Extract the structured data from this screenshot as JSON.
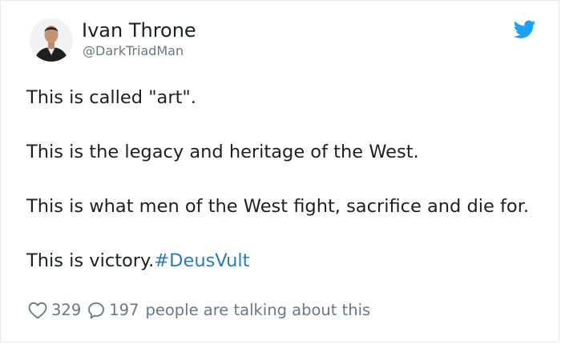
{
  "tweet": {
    "author_name": "Ivan Throne",
    "author_handle": "@DarkTriadMan",
    "text_lines": [
      "This is called \"art\".",
      "This is the legacy and heritage of the West.",
      "This is what men of the West fight, sacrifice and die for.",
      "This is victory."
    ],
    "hashtag": "#DeusVult",
    "likes": "329",
    "comments": "197",
    "talking_label": "people are talking about this"
  },
  "colors": {
    "twitter_blue": "#1da1f2",
    "link_blue": "#2b7bb9",
    "muted_gray": "#697882",
    "text_dark": "#1c2022"
  },
  "icons": {
    "brand": "twitter-bird-icon",
    "like": "heart-icon",
    "reply": "speech-bubble-icon"
  }
}
